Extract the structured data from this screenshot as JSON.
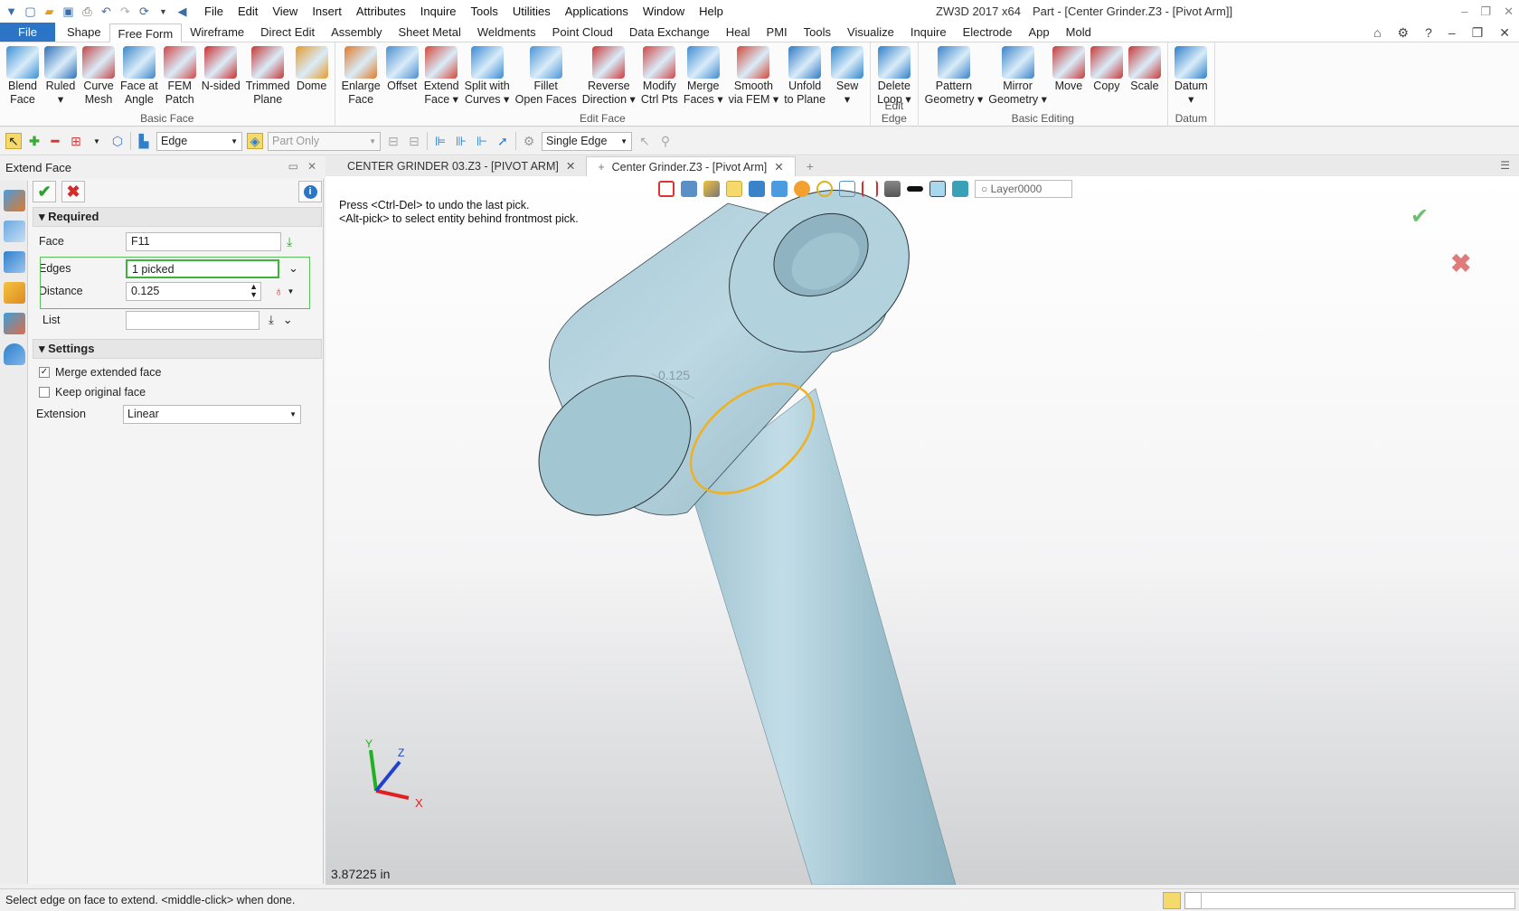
{
  "window": {
    "app_title": "ZW3D 2017  x64",
    "doc_title": "Part - [Center Grinder.Z3 - [Pivot Arm]]",
    "menu": [
      "File",
      "Edit",
      "View",
      "Insert",
      "Attributes",
      "Inquire",
      "Tools",
      "Utilities",
      "Applications",
      "Window",
      "Help"
    ]
  },
  "ribbon_tabs": [
    "File",
    "Shape",
    "Free Form",
    "Wireframe",
    "Direct Edit",
    "Assembly",
    "Sheet Metal",
    "Weldments",
    "Point Cloud",
    "Data Exchange",
    "Heal",
    "PMI",
    "Tools",
    "Visualize",
    "Inquire",
    "Electrode",
    "App",
    "Mold"
  ],
  "active_tab": "Free Form",
  "ribbon": {
    "basic_face": {
      "name": "Basic Face",
      "buttons": [
        {
          "label": "Blend\nFace",
          "color": "#3a8fd6"
        },
        {
          "label": "Ruled\n▾",
          "color": "#2f6fb8"
        },
        {
          "label": "Curve\nMesh",
          "color": "#c14848"
        },
        {
          "label": "Face at\nAngle",
          "color": "#3b86c9"
        },
        {
          "label": "FEM\nPatch",
          "color": "#d04747"
        },
        {
          "label": "N-sided",
          "color": "#cc2f2f"
        },
        {
          "label": "Trimmed\nPlane",
          "color": "#c43838"
        },
        {
          "label": "Dome",
          "color": "#e59a2d"
        }
      ]
    },
    "edit_face": {
      "name": "Edit Face",
      "buttons": [
        {
          "label": "Enlarge\nFace",
          "color": "#e07a2a"
        },
        {
          "label": "Offset",
          "color": "#4a8ed0"
        },
        {
          "label": "Extend\nFace ▾",
          "color": "#d5473a"
        },
        {
          "label": "Split with\nCurves ▾",
          "color": "#3a8ad3"
        },
        {
          "label": "Fillet\nOpen Faces",
          "color": "#4a94d6"
        },
        {
          "label": "Reverse\nDirection ▾",
          "color": "#cc3b3b"
        },
        {
          "label": "Modify\nCtrl Pts",
          "color": "#d14747"
        },
        {
          "label": "Merge\nFaces ▾",
          "color": "#3f8bd1"
        },
        {
          "label": "Smooth\nvia FEM ▾",
          "color": "#cf4a3a"
        },
        {
          "label": "Unfold\nto Plane",
          "color": "#2f78c4"
        },
        {
          "label": "Sew\n▾",
          "color": "#2f85cc"
        }
      ]
    },
    "edit_edge": {
      "name": "Edit Edge",
      "buttons": [
        {
          "label": "Delete\nLoop ▾",
          "color": "#2f7fcb"
        }
      ]
    },
    "basic_editing": {
      "name": "Basic Editing",
      "buttons": [
        {
          "label": "Pattern\nGeometry ▾",
          "color": "#3a82c9"
        },
        {
          "label": "Mirror\nGeometry ▾",
          "color": "#3a82c9"
        },
        {
          "label": "Move",
          "color": "#c73a3a"
        },
        {
          "label": "Copy",
          "color": "#c73a3a"
        },
        {
          "label": "Scale",
          "color": "#c73a3a"
        }
      ]
    },
    "datum": {
      "name": "Datum",
      "buttons": [
        {
          "label": "Datum\n▾",
          "color": "#2f7fcb"
        }
      ]
    }
  },
  "selection_toolbar": {
    "filter": "Edge",
    "scope": "Part Only",
    "pick_mode": "Single Edge"
  },
  "panel": {
    "title": "Extend Face",
    "required_label": "Required",
    "face_label": "Face",
    "face_value": "F11",
    "edges_label": "Edges",
    "edges_value": "1 picked",
    "distance_label": "Distance",
    "distance_value": "0.125",
    "list_label": "List",
    "list_value": "",
    "settings_label": "Settings",
    "merge_label": "Merge extended face",
    "merge_checked": true,
    "keep_label": "Keep original face",
    "keep_checked": false,
    "extension_label": "Extension",
    "extension_value": "Linear"
  },
  "doc_tabs": [
    {
      "label": "CENTER GRINDER 03.Z3 - [PIVOT ARM]",
      "active": false
    },
    {
      "label": "Center Grinder.Z3 - [Pivot Arm]",
      "active": true
    }
  ],
  "viewport": {
    "layer": "Layer0000",
    "hint_line1": "Press <Ctrl-Del> to undo the last pick.",
    "hint_line2": "<Alt-pick> to select entity behind frontmost pick.",
    "dimension": "0.125",
    "coordinate": "3.87225 in",
    "axis_labels": {
      "x": "X",
      "y": "Y",
      "z": "Z"
    },
    "part_color": "#a9cbd8",
    "highlight_color": "#f0b020"
  },
  "status": {
    "prompt": "Select edge on face to extend.  <middle-click> when done."
  }
}
